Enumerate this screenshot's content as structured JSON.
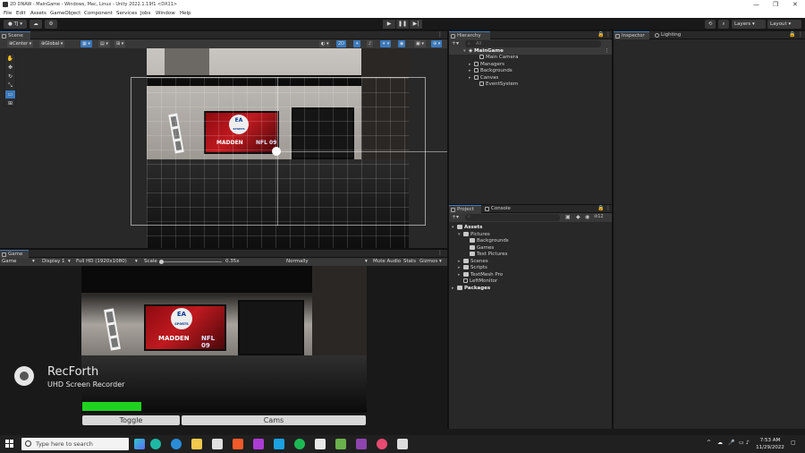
{
  "window": {
    "title": "2D DNAW - MainGame - Windows, Mac, Linux - Unity 2022.1.19f1 <DX11>",
    "controls": [
      "—",
      "❐",
      "✕"
    ]
  },
  "menu": [
    "File",
    "Edit",
    "Assets",
    "GameObject",
    "Component",
    "Services",
    "Jobs",
    "Window",
    "Help"
  ],
  "toolbar": {
    "account": "TJ",
    "cloud_icon": "cloud-icon",
    "collab_icon": "collab-icon",
    "play": "▶",
    "pause": "❚❚",
    "step": "▶|",
    "history_icon": "history-icon",
    "search_icon": "search-icon",
    "layers": "Layers",
    "layout": "Layout"
  },
  "scene": {
    "tab": "Scene",
    "pivot": "Center",
    "space": "Global"
  },
  "game": {
    "tab": "Game",
    "mode": "Game",
    "display": "Display 1",
    "resolution": "Full HD (1920x1080)",
    "scale_label": "Scale",
    "scale_value": "0.35x",
    "vsync": "Normally",
    "mute": "Mute Audio",
    "stats": "Stats",
    "gizmos": "Gizmos",
    "toggle_button": "Toggle",
    "cams_button": "Cams",
    "progress": 1.0,
    "progress_color": "#1fd21f"
  },
  "screen_content": {
    "ea_text": "EA",
    "sports_text": "SPORTS",
    "madden_text": "MADDEN",
    "nfl_text": "NFL 09"
  },
  "watermark": {
    "brand": "RecForth",
    "subtitle": "UHD Screen Recorder"
  },
  "hierarchy": {
    "tab": "Hierarchy",
    "search_placeholder": "All",
    "root": "MainGame",
    "items": [
      "Main Camera",
      "Managers",
      "Backgrounds",
      "Canvas",
      "EventSystem"
    ]
  },
  "project": {
    "tabs": [
      "Project",
      "Console"
    ],
    "badge": "12",
    "tree": [
      {
        "label": "Assets",
        "level": 0,
        "bold": true
      },
      {
        "label": "Pictures",
        "level": 1
      },
      {
        "label": "Backgrounds",
        "level": 2
      },
      {
        "label": "Games",
        "level": 2
      },
      {
        "label": "Test Pictures",
        "level": 2
      },
      {
        "label": "Scenes",
        "level": 1
      },
      {
        "label": "Scripts",
        "level": 1
      },
      {
        "label": "TextMesh Pro",
        "level": 1
      },
      {
        "label": "LeftMonitor",
        "level": 1
      },
      {
        "label": "Packages",
        "level": 0,
        "bold": true
      }
    ]
  },
  "inspector": {
    "tabs": [
      "Inspector",
      "Lighting"
    ]
  },
  "taskbar": {
    "search_placeholder": "Type here to search",
    "time": "7:53 AM",
    "date": "11/29/2022"
  }
}
